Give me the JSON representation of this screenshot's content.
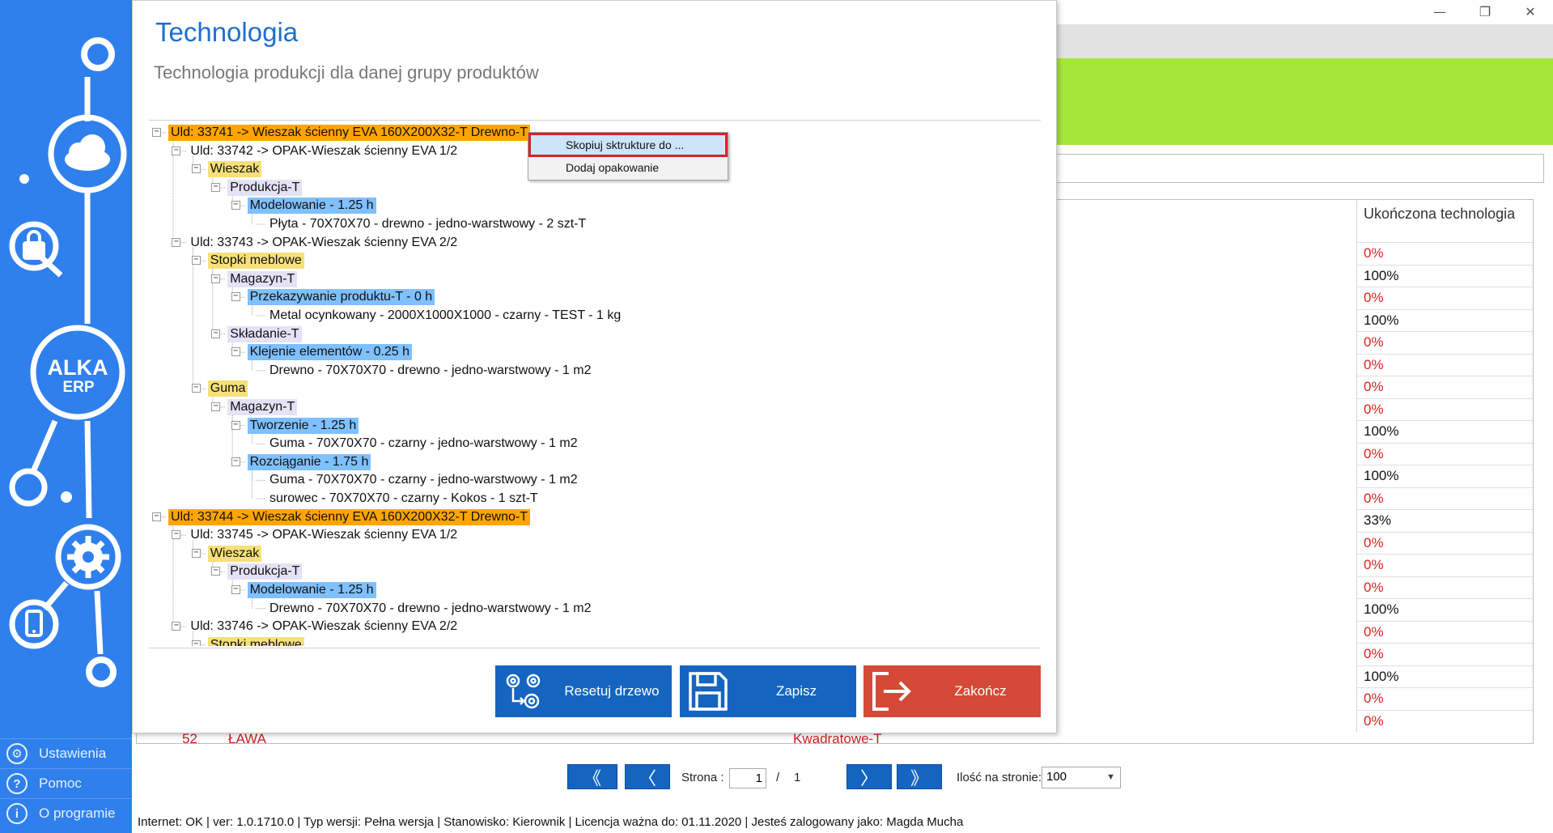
{
  "window_controls": {
    "minimize": "—",
    "restore": "❐",
    "close": "✕"
  },
  "background_table": {
    "column_header": "Ukończona technologia",
    "rows": [
      {
        "value": "0%",
        "status": "zero"
      },
      {
        "value": "100%",
        "status": "full"
      },
      {
        "value": "0%",
        "status": "zero"
      },
      {
        "value": "100%",
        "status": "full"
      },
      {
        "value": "0%",
        "status": "zero"
      },
      {
        "value": "0%",
        "status": "zero"
      },
      {
        "value": "0%",
        "status": "zero"
      },
      {
        "value": "0%",
        "status": "zero"
      },
      {
        "value": "100%",
        "status": "full"
      },
      {
        "value": "0%",
        "status": "zero"
      },
      {
        "value": "100%",
        "status": "full"
      },
      {
        "value": "0%",
        "status": "zero"
      },
      {
        "value": "33%",
        "status": "partial"
      },
      {
        "value": "0%",
        "status": "zero"
      },
      {
        "value": "0%",
        "status": "zero"
      },
      {
        "value": "0%",
        "status": "zero"
      },
      {
        "value": "100%",
        "status": "full"
      },
      {
        "value": "0%",
        "status": "zero"
      },
      {
        "value": "0%",
        "status": "zero"
      },
      {
        "value": "100%",
        "status": "full"
      },
      {
        "value": "0%",
        "status": "zero"
      },
      {
        "value": "0%",
        "status": "zero"
      }
    ],
    "partial_bottom_row": {
      "lp": "52",
      "name": "ŁAWA",
      "technology": "Kwadratowe-T"
    }
  },
  "pager": {
    "first": "《",
    "prev": "〈",
    "next": "〉",
    "last": "》",
    "page_label": "Strona :",
    "page_value": "1",
    "page_separator": "/",
    "page_total": "1",
    "per_page_label": "Ilość na stronie:",
    "per_page_value": "100"
  },
  "statusbar": "Internet: OK  |  ver: 1.0.1710.0  |  Typ wersji: Pełna wersja  |  Stanowisko: Kierownik  |  Licencja ważna do: 01.11.2020  |  Jesteś zalogowany jako: Magda Mucha",
  "sidebar": {
    "logo_top": "ALKA",
    "logo_bottom": "ERP",
    "menu": [
      {
        "label": "Ustawienia",
        "icon": "gear-icon"
      },
      {
        "label": "Pomoc",
        "icon": "help-icon"
      },
      {
        "label": "O programie",
        "icon": "info-icon"
      }
    ]
  },
  "dialog": {
    "title": "Technologia",
    "subtitle": "Technologia produkcji dla danej grupy produktów",
    "tree": [
      {
        "level": 0,
        "text": "Uld: 33741 -> Wieszak ścienny EVA 160X200X32-T Drewno-T",
        "hl": "orange",
        "exp": true
      },
      {
        "level": 1,
        "text": "Uld: 33742 -> OPAK-Wieszak ścienny EVA   1/2",
        "hl": "none",
        "exp": true
      },
      {
        "level": 2,
        "text": "Wieszak",
        "hl": "yellow",
        "exp": true
      },
      {
        "level": 3,
        "text": "Produkcja-T",
        "hl": "lilac",
        "exp": true
      },
      {
        "level": 4,
        "text": "Modelowanie - 1.25 h",
        "hl": "blue",
        "exp": true
      },
      {
        "level": 5,
        "text": "Płyta - 70X70X70 -  drewno -  jedno-warstwowy - 2 szt-T",
        "hl": "none",
        "exp": false
      },
      {
        "level": 1,
        "text": "Uld: 33743 -> OPAK-Wieszak ścienny EVA   2/2",
        "hl": "none",
        "exp": true
      },
      {
        "level": 2,
        "text": "Stopki meblowe",
        "hl": "yellow",
        "exp": true
      },
      {
        "level": 3,
        "text": "Magazyn-T",
        "hl": "lilac",
        "exp": true
      },
      {
        "level": 4,
        "text": "Przekazywanie produktu-T - 0 h",
        "hl": "blue",
        "exp": true
      },
      {
        "level": 5,
        "text": "Metal ocynkowany - 2000X1000X1000 -  czarny -  TEST - 1 kg",
        "hl": "none",
        "exp": false
      },
      {
        "level": 3,
        "text": "Składanie-T",
        "hl": "lilac",
        "exp": true
      },
      {
        "level": 4,
        "text": "Klejenie elementów - 0.25 h",
        "hl": "blue",
        "exp": true
      },
      {
        "level": 5,
        "text": "Drewno - 70X70X70 -  drewno -  jedno-warstwowy - 1 m2",
        "hl": "none",
        "exp": false
      },
      {
        "level": 2,
        "text": "Guma",
        "hl": "yellow",
        "exp": true
      },
      {
        "level": 3,
        "text": "Magazyn-T",
        "hl": "lilac",
        "exp": true
      },
      {
        "level": 4,
        "text": "Tworzenie - 1.25 h",
        "hl": "blue",
        "exp": true
      },
      {
        "level": 5,
        "text": "Guma - 70X70X70 -  czarny -  jedno-warstwowy - 1 m2",
        "hl": "none",
        "exp": false
      },
      {
        "level": 4,
        "text": "Rozciąganie - 1.75 h",
        "hl": "blue",
        "exp": true
      },
      {
        "level": 5,
        "text": "Guma - 70X70X70 -  czarny -  jedno-warstwowy - 1 m2",
        "hl": "none",
        "exp": false
      },
      {
        "level": 5,
        "text": "surowec - 70X70X70 -  czarny -  Kokos - 1 szt-T",
        "hl": "none",
        "exp": false
      },
      {
        "level": 0,
        "text": "Uld: 33744 -> Wieszak ścienny EVA 160X200X32-T Drewno-T",
        "hl": "orange",
        "exp": true
      },
      {
        "level": 1,
        "text": "Uld: 33745 -> OPAK-Wieszak ścienny EVA   1/2",
        "hl": "none",
        "exp": true
      },
      {
        "level": 2,
        "text": "Wieszak",
        "hl": "yellow",
        "exp": true
      },
      {
        "level": 3,
        "text": "Produkcja-T",
        "hl": "lilac",
        "exp": true
      },
      {
        "level": 4,
        "text": "Modelowanie - 1.25 h",
        "hl": "blue",
        "exp": true
      },
      {
        "level": 5,
        "text": "Drewno - 70X70X70 -  drewno -  jedno-warstwowy - 1 m2",
        "hl": "none",
        "exp": false
      },
      {
        "level": 1,
        "text": "Uld: 33746 -> OPAK-Wieszak ścienny EVA   2/2",
        "hl": "none",
        "exp": true
      },
      {
        "level": 2,
        "text": "Stopki meblowe",
        "hl": "yellow",
        "exp": true
      }
    ],
    "context_menu": {
      "copy_structure": "Skopiuj sktrukture do ...",
      "add_packaging": "Dodaj opakowanie"
    },
    "buttons": {
      "reset": "Resetuj drzewo",
      "save": "Zapisz",
      "exit": "Zakończ"
    }
  },
  "colors": {
    "sidebar": "#2f80ed",
    "accent_green": "#a6e63c",
    "primary_button": "#1565c0",
    "exit_button": "#d44a36",
    "orange_node": "#ffa500",
    "yellow_node": "#f5e07a",
    "lilac_node": "#e4e2f6",
    "blue_node": "#7fc0ff",
    "percent_zero": "#e02020"
  }
}
